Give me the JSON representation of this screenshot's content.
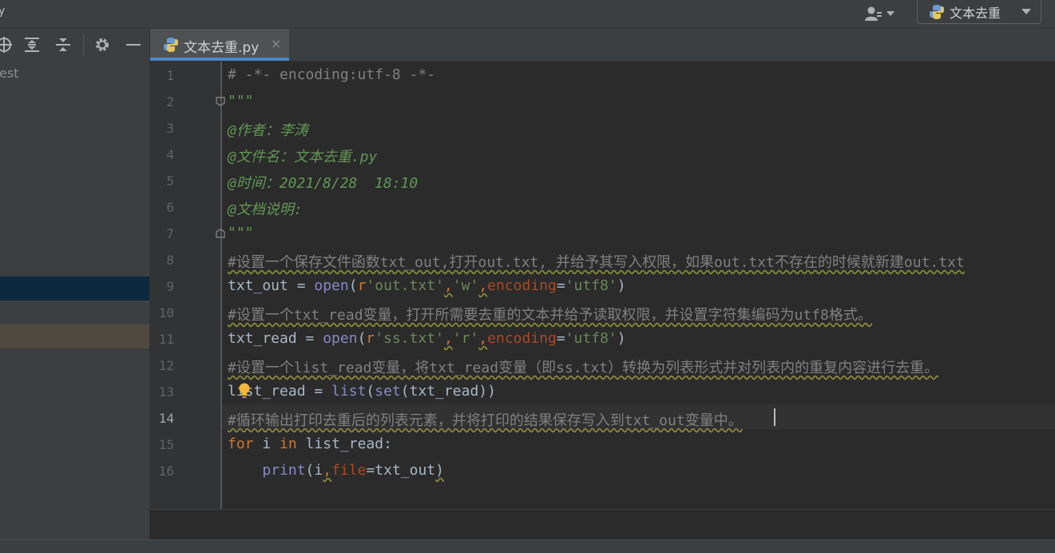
{
  "window": {
    "title_fragment": "y"
  },
  "run_config": {
    "label": "文本去重"
  },
  "project_tree": {
    "visible_fragment": "est"
  },
  "tab": {
    "title": "文本去重.py",
    "close": "×"
  },
  "editor": {
    "active_line": 14,
    "line_numbers": [
      "1",
      "2",
      "3",
      "4",
      "5",
      "6",
      "7",
      "8",
      "9",
      "10",
      "11",
      "12",
      "13",
      "14",
      "15",
      "16"
    ],
    "lines": [
      [
        {
          "t": "# -*- encoding:utf-8 -*-",
          "c": "c-comment"
        }
      ],
      [
        {
          "t": "\"\"\"",
          "c": "c-doc"
        }
      ],
      [
        {
          "t": "@作者：李涛",
          "c": "c-doc"
        }
      ],
      [
        {
          "t": "@文件名：文本去重.py",
          "c": "c-doc"
        }
      ],
      [
        {
          "t": "@时间：2021/8/28  18:10",
          "c": "c-doc"
        }
      ],
      [
        {
          "t": "@文档说明:",
          "c": "c-doc"
        }
      ],
      [
        {
          "t": "\"\"\"",
          "c": "c-doc"
        }
      ],
      [
        {
          "t": "#设置一个保存文件函数txt_out,打开out.txt, 并给予其写入权限，如果out.txt不存在的时候就新建out.txt",
          "c": "c-comment wavy"
        }
      ],
      [
        {
          "t": "txt_out = ",
          "c": ""
        },
        {
          "t": "open",
          "c": "c-builtin"
        },
        {
          "t": "(",
          "c": ""
        },
        {
          "t": "r",
          "c": "c-kw"
        },
        {
          "t": "'out.txt'",
          "c": "c-str"
        },
        {
          "t": ",",
          "c": "c-kw wavy"
        },
        {
          "t": "'w'",
          "c": "c-str"
        },
        {
          "t": ",",
          "c": "c-kw wavy"
        },
        {
          "t": "encoding",
          "c": "c-param"
        },
        {
          "t": "=",
          "c": ""
        },
        {
          "t": "'utf8'",
          "c": "c-str"
        },
        {
          "t": ")",
          "c": ""
        }
      ],
      [
        {
          "t": "#设置一个txt_read变量，打开所需要去重的文本并给予读取权限，并设置字符集编码为utf8格式。",
          "c": "c-comment wavy"
        }
      ],
      [
        {
          "t": "txt_read = ",
          "c": ""
        },
        {
          "t": "open",
          "c": "c-builtin"
        },
        {
          "t": "(",
          "c": ""
        },
        {
          "t": "r",
          "c": "c-kw"
        },
        {
          "t": "'ss.txt'",
          "c": "c-str"
        },
        {
          "t": ",",
          "c": "c-kw wavy"
        },
        {
          "t": "'r'",
          "c": "c-str"
        },
        {
          "t": ",",
          "c": "c-kw wavy"
        },
        {
          "t": "encoding",
          "c": "c-param"
        },
        {
          "t": "=",
          "c": ""
        },
        {
          "t": "'utf8'",
          "c": "c-str"
        },
        {
          "t": ")",
          "c": ""
        }
      ],
      [
        {
          "t": "#设置一个list_read变量，将txt_read变量（即ss.txt）转换为列表形式并对列表内的重复内容进行去重。",
          "c": "c-comment wavy"
        }
      ],
      [
        {
          "t": "list_read = ",
          "c": ""
        },
        {
          "t": "list",
          "c": "c-builtin"
        },
        {
          "t": "(",
          "c": ""
        },
        {
          "t": "set",
          "c": "c-builtin"
        },
        {
          "t": "(txt_read))",
          "c": ""
        }
      ],
      [
        {
          "t": "#循环输出打印去重后的列表元素，并将打印的结果保存写入到txt_out变量中。",
          "c": "c-comment wavy"
        }
      ],
      [
        {
          "t": "for ",
          "c": "c-kw"
        },
        {
          "t": "i ",
          "c": ""
        },
        {
          "t": "in ",
          "c": "c-kw"
        },
        {
          "t": "list_read:",
          "c": ""
        }
      ],
      [
        {
          "t": "    ",
          "c": ""
        },
        {
          "t": "print",
          "c": "c-builtin"
        },
        {
          "t": "(i",
          "c": ""
        },
        {
          "t": ",",
          "c": "c-kw wavy"
        },
        {
          "t": "file",
          "c": "c-param"
        },
        {
          "t": "=txt_out",
          "c": ""
        },
        {
          "t": ")",
          "c": "wavy"
        }
      ]
    ]
  },
  "colors": {
    "background": "#2b2b2b",
    "panel": "#3c3f41",
    "tab_underline": "#4a88c7",
    "comment": "#808080",
    "docstring": "#629755",
    "keyword": "#cc7832",
    "builtin": "#8888c6",
    "string": "#6a8759",
    "param": "#aa4926"
  },
  "icons": [
    "user-icon",
    "python-icon",
    "target-icon",
    "expand-all-icon",
    "collapse-all-icon",
    "gear-icon",
    "minimize-icon",
    "close-icon",
    "fold-icon",
    "intention-bulb-icon"
  ]
}
